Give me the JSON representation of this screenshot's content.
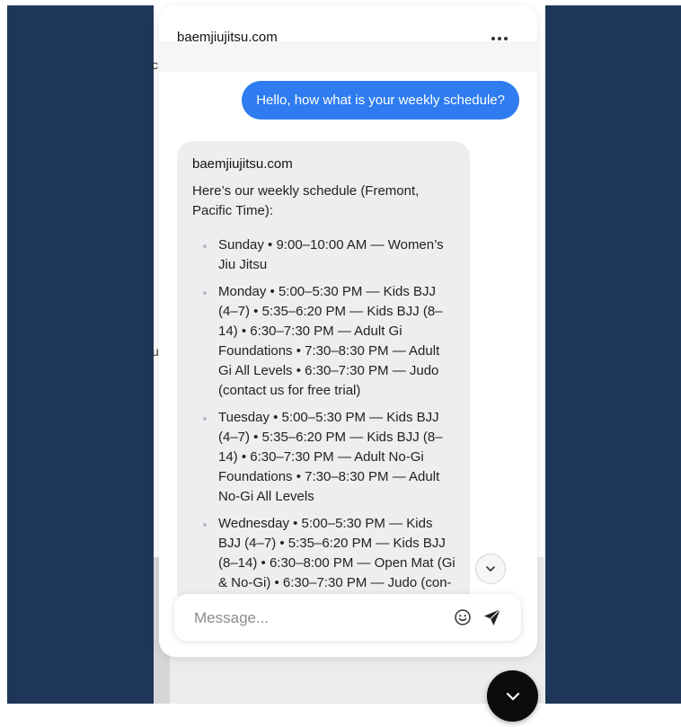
{
  "header": {
    "title": "baemjiujitsu.com",
    "menu_icon": "more-horizontal-icon"
  },
  "background": {
    "peek_texts": [
      "c",
      "u"
    ]
  },
  "messages": {
    "user": "Hello, how what is your weekly schedule?",
    "bot": {
      "sender": "baemjiujitsu.com",
      "intro": "Here’s our weekly schedule (Fremont, Pacific Time):",
      "schedule": [
        "Sunday • 9:00–10:00 AM — Women’s Jiu Jitsu",
        "Monday • 5:00–5:30 PM — Kids BJJ (4–7) • 5:35–6:20 PM — Kids BJJ (8–14) • 6:30–7:30 PM — Adult Gi Foundations • 7:30–8:30 PM — Adult Gi All Levels • 6:30–7:30 PM — Judo (contact us for free trial)",
        "Tuesday • 5:00–5:30 PM — Kids BJJ (4–7) • 5:35–6:20 PM — Kids BJJ (8–14) • 6:30–7:30 PM — Adult No-Gi Foundations • 7:30–8:30 PM — Adult No-Gi All Levels",
        "Wednesday • 5:00–5:30 PM — Kids BJJ (4–7) • 5:35–6:20 PM — Kids BJJ (8–14) • 6:30–8:00 PM — Open Mat (Gi & No-Gi) • 6:30–7:30 PM — Judo (con-"
      ]
    }
  },
  "composer": {
    "placeholder": "Message...",
    "emoji_icon": "smile-icon",
    "send_icon": "send-icon"
  },
  "controls": {
    "scroll_icon": "chevron-down-icon",
    "fab_icon": "chevron-down-icon"
  },
  "colors": {
    "background": "#1e3657",
    "user_bubble": "#2e7cf0",
    "bot_bubble": "#eeeef1",
    "fab": "#0c0c0c"
  }
}
